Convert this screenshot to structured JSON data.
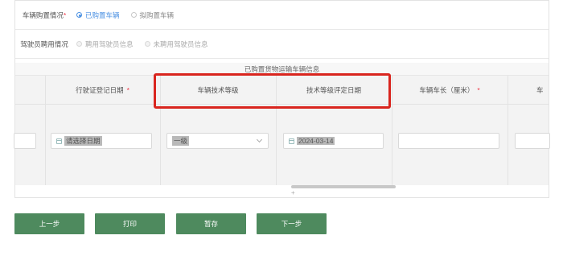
{
  "vehicle_purchase": {
    "label": "车辆购置情况",
    "required_mark": "*",
    "options": [
      "已购置车辆",
      "拟购置车辆"
    ],
    "selected": "已购置车辆"
  },
  "driver_hire": {
    "label": "驾驶员聘用情况",
    "options": [
      "聘用驾驶员信息",
      "未聘用驾驶员信息"
    ]
  },
  "section_title": "已购置货物运输车辆信息",
  "columns": {
    "reg_date": "行驶证登记日期",
    "tech_grade": "车辆技术等级",
    "grade_date": "技术等级评定日期",
    "length": "车辆车长（厘米）",
    "required_mark": "*",
    "partial_next": "车"
  },
  "cells": {
    "reg_date_placeholder": "请选择日期",
    "tech_grade_value": "一级",
    "grade_date_value": "2024-03-14",
    "length_value": ""
  },
  "plus_sign": "+",
  "buttons": {
    "prev": "上一步",
    "print": "打印",
    "save": "暂存",
    "next": "下一步"
  },
  "colors": {
    "button_bg": "#4e8a5e",
    "highlight": "#d9251e",
    "radio_accent": "#4a90e2"
  }
}
